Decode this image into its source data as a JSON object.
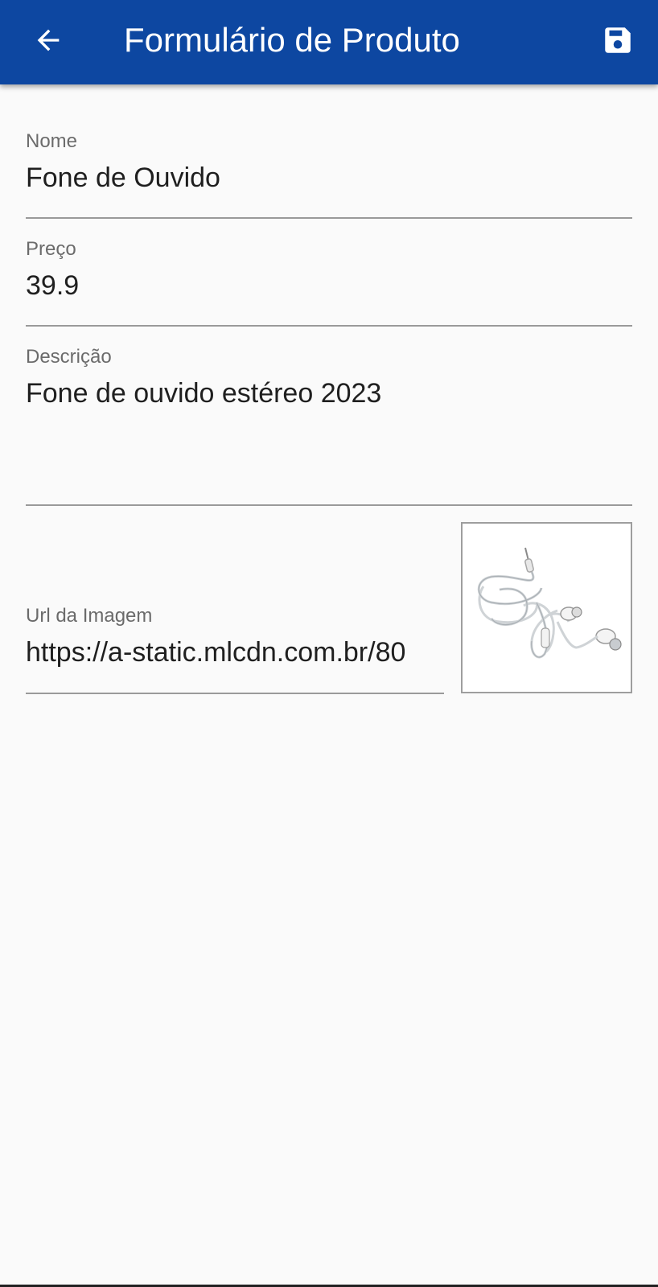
{
  "appbar": {
    "title": "Formulário de Produto",
    "back_icon": "arrow-left-icon",
    "save_icon": "floppy-disk-icon",
    "color": "#0d47a1"
  },
  "form": {
    "nome": {
      "label": "Nome",
      "value": "Fone de Ouvido"
    },
    "preco": {
      "label": "Preço",
      "value": "39.9"
    },
    "descricao": {
      "label": "Descrição",
      "value": "Fone de ouvido estéreo 2023"
    },
    "url_imagem": {
      "label": "Url da Imagem",
      "value": "https://a-static.mlcdn.com.br/80"
    }
  },
  "image_preview": {
    "icon": "earphones-image"
  }
}
